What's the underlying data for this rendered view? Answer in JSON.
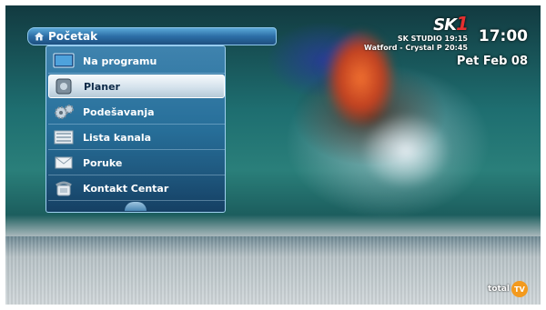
{
  "menu": {
    "title": "Početak",
    "items": [
      {
        "label": "Na programu",
        "icon": "tv-screen-icon",
        "selected": false
      },
      {
        "label": "Planer",
        "icon": "planner-phone-icon",
        "selected": true
      },
      {
        "label": "Podešavanja",
        "icon": "gears-icon",
        "selected": false
      },
      {
        "label": "Lista kanala",
        "icon": "channel-list-icon",
        "selected": false
      },
      {
        "label": "Poruke",
        "icon": "envelope-icon",
        "selected": false
      },
      {
        "label": "Kontakt Centar",
        "icon": "telephone-icon",
        "selected": false
      }
    ]
  },
  "channel": {
    "logo_text": "SK",
    "logo_number": "1",
    "now": "SK STUDIO 19:15",
    "next": "Watford - Crystal P 20:45"
  },
  "clock": {
    "time": "17:00",
    "date": "Pet Feb 08"
  },
  "brand": {
    "text": "total",
    "badge": "TV"
  },
  "colors": {
    "accent": "#2c6ea6",
    "selected_bg": "#d4e2ec",
    "brand_orange": "#f39a1e",
    "logo_red": "#e53030"
  }
}
